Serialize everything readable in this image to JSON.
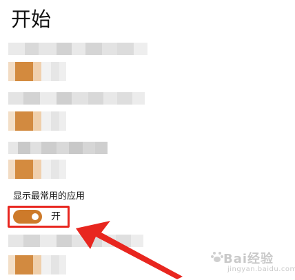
{
  "page": {
    "title": "开始"
  },
  "settings": {
    "label": "显示最常用的应用",
    "toggle": {
      "state": "开",
      "on": true
    }
  },
  "watermark": {
    "brand": "Bai经验",
    "url": "jingyan.baidu.com"
  },
  "colors": {
    "accent": "#cd7a2a",
    "highlight": "#e8261f"
  },
  "icons": [
    "arrow-pointer-icon",
    "paw-icon"
  ]
}
